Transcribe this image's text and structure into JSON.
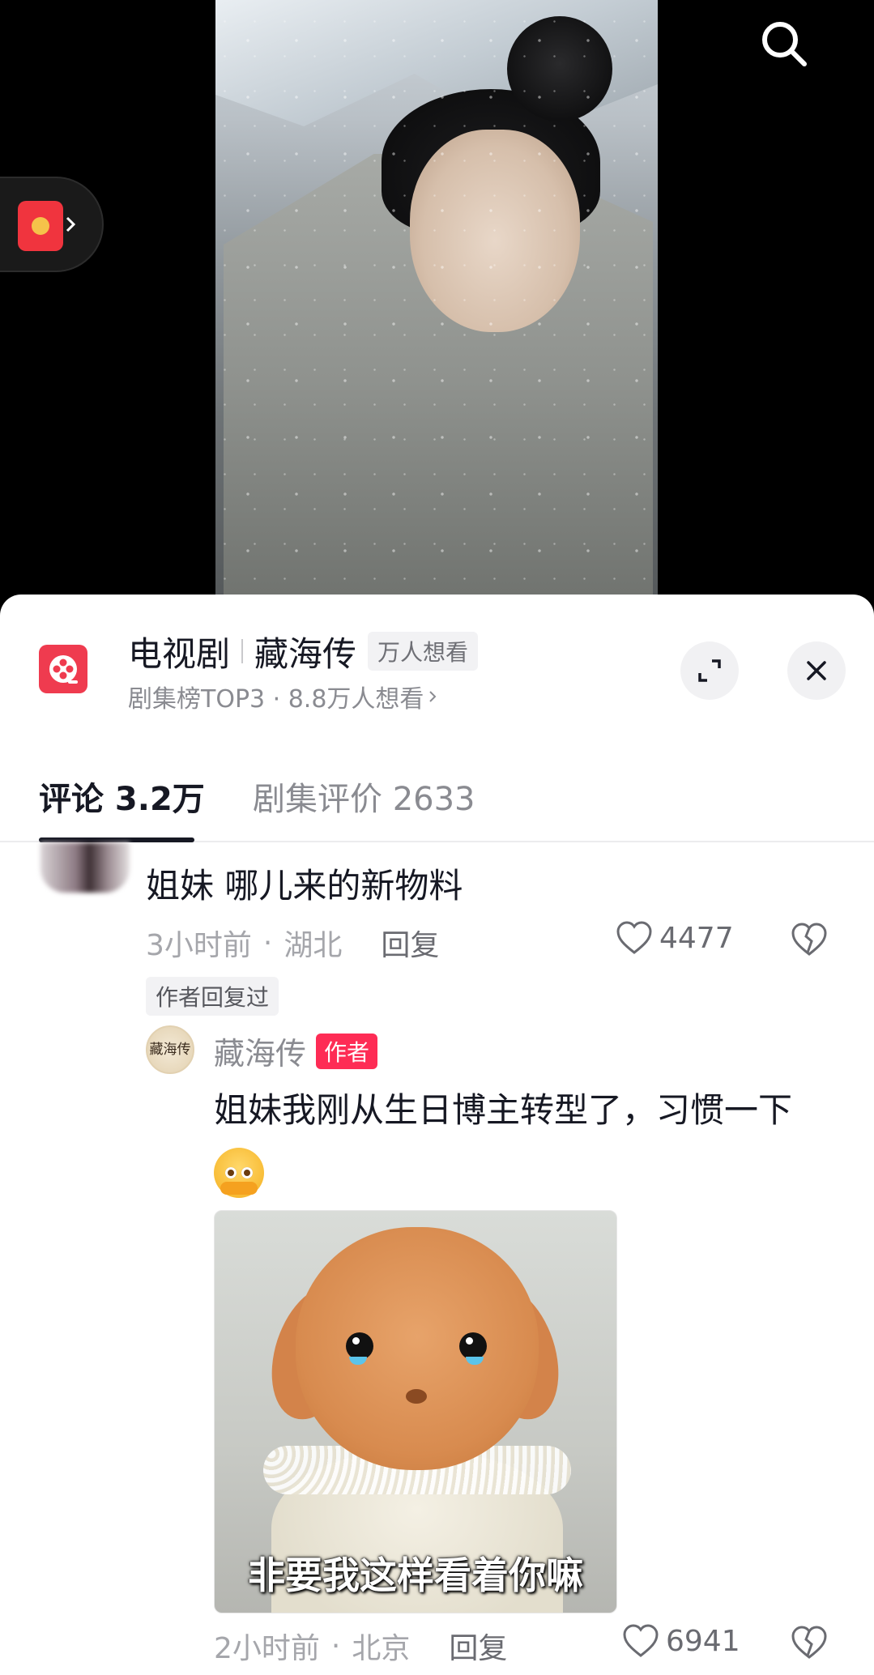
{
  "show": {
    "category": "电视剧",
    "name": "藏海传",
    "want_badge": "万人想看",
    "subtitle": "剧集榜TOP3 · 8.8万人想看"
  },
  "tabs": [
    {
      "label": "评论 3.2万",
      "active": true
    },
    {
      "label": "剧集评价 2633",
      "active": false
    }
  ],
  "comments": [
    {
      "text": "姐妹 哪儿来的新物料",
      "time": "3小时前",
      "location": "湖北",
      "reply_label": "回复",
      "likes": "4477",
      "author_replied_tag": "作者回复过",
      "reply": {
        "author_name": "藏海传",
        "author_badge": "作者",
        "avatar_text": "藏海传",
        "text": "姐妹我刚从生日博主转型了，习惯一下",
        "emoji": "crying-face-emoji",
        "sticker_caption": "非要我这样看着你嘛",
        "time": "2小时前",
        "location": "北京",
        "reply_label": "回复",
        "likes": "6941"
      }
    }
  ],
  "icons": {
    "search": "search-icon",
    "red_packet": "red-packet-icon",
    "show_logo": "film-reel-icon",
    "expand": "expand-icon",
    "close": "close-icon",
    "like": "heart-icon",
    "dislike": "broken-heart-icon"
  },
  "colors": {
    "accent": "#fe2c55",
    "logo": "#ef3b4f",
    "text_primary": "#161823",
    "text_secondary": "#8a8b91"
  }
}
